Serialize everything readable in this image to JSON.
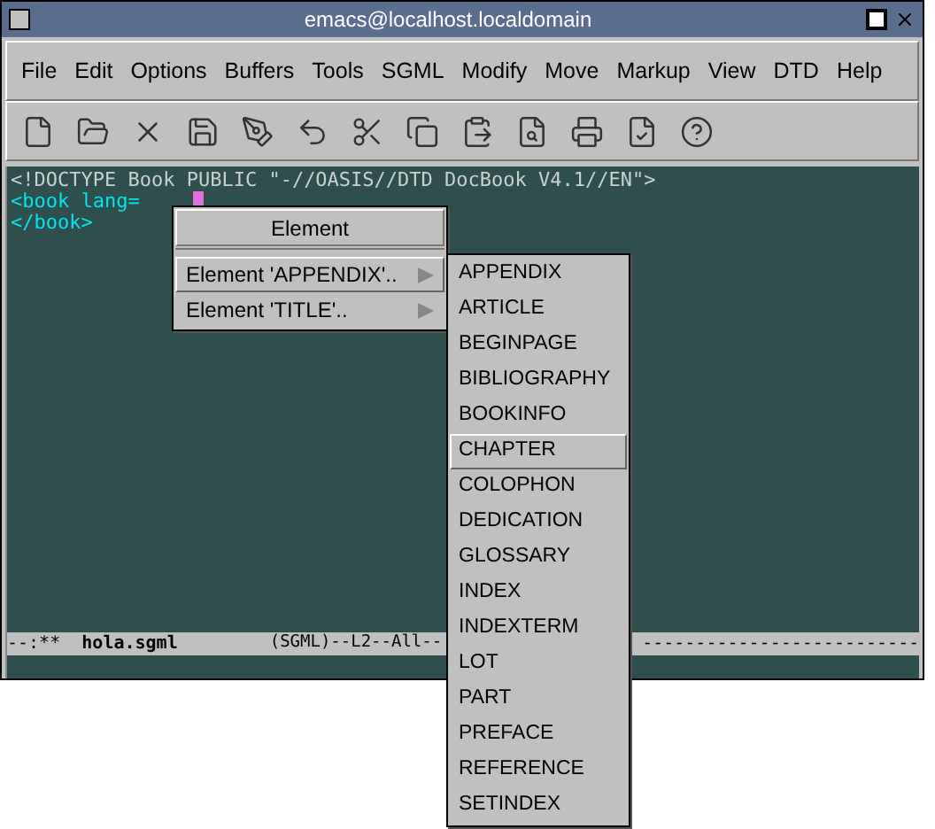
{
  "window": {
    "title": "emacs@localhost.localdomain"
  },
  "menubar": [
    "File",
    "Edit",
    "Options",
    "Buffers",
    "Tools",
    "SGML",
    "Modify",
    "Move",
    "Markup",
    "View",
    "DTD",
    "Help"
  ],
  "editor": {
    "lines": [
      "<!DOCTYPE Book PUBLIC \"-//OASIS//DTD DocBook V4.1//EN\">",
      "<book lang=",
      "</book>"
    ]
  },
  "mode_line": {
    "left": "--:**  ",
    "buffer": "hola.sgml",
    "mode": "(SGML)--L2--All--",
    "tail": "--------------------------"
  },
  "popup_menu": {
    "title": "Element",
    "items": [
      {
        "label": "Element 'APPENDIX'..",
        "selected": true
      },
      {
        "label": "Element 'TITLE'..",
        "selected": false
      }
    ]
  },
  "submenu": {
    "items": [
      {
        "label": "APPENDIX",
        "selected": false
      },
      {
        "label": "ARTICLE",
        "selected": false
      },
      {
        "label": "BEGINPAGE",
        "selected": false
      },
      {
        "label": "BIBLIOGRAPHY",
        "selected": false
      },
      {
        "label": "BOOKINFO",
        "selected": false
      },
      {
        "label": "CHAPTER",
        "selected": true
      },
      {
        "label": "COLOPHON",
        "selected": false
      },
      {
        "label": "DEDICATION",
        "selected": false
      },
      {
        "label": "GLOSSARY",
        "selected": false
      },
      {
        "label": "INDEX",
        "selected": false
      },
      {
        "label": "INDEXTERM",
        "selected": false
      },
      {
        "label": "LOT",
        "selected": false
      },
      {
        "label": "PART",
        "selected": false
      },
      {
        "label": "PREFACE",
        "selected": false
      },
      {
        "label": "REFERENCE",
        "selected": false
      },
      {
        "label": "SETINDEX",
        "selected": false
      }
    ]
  }
}
